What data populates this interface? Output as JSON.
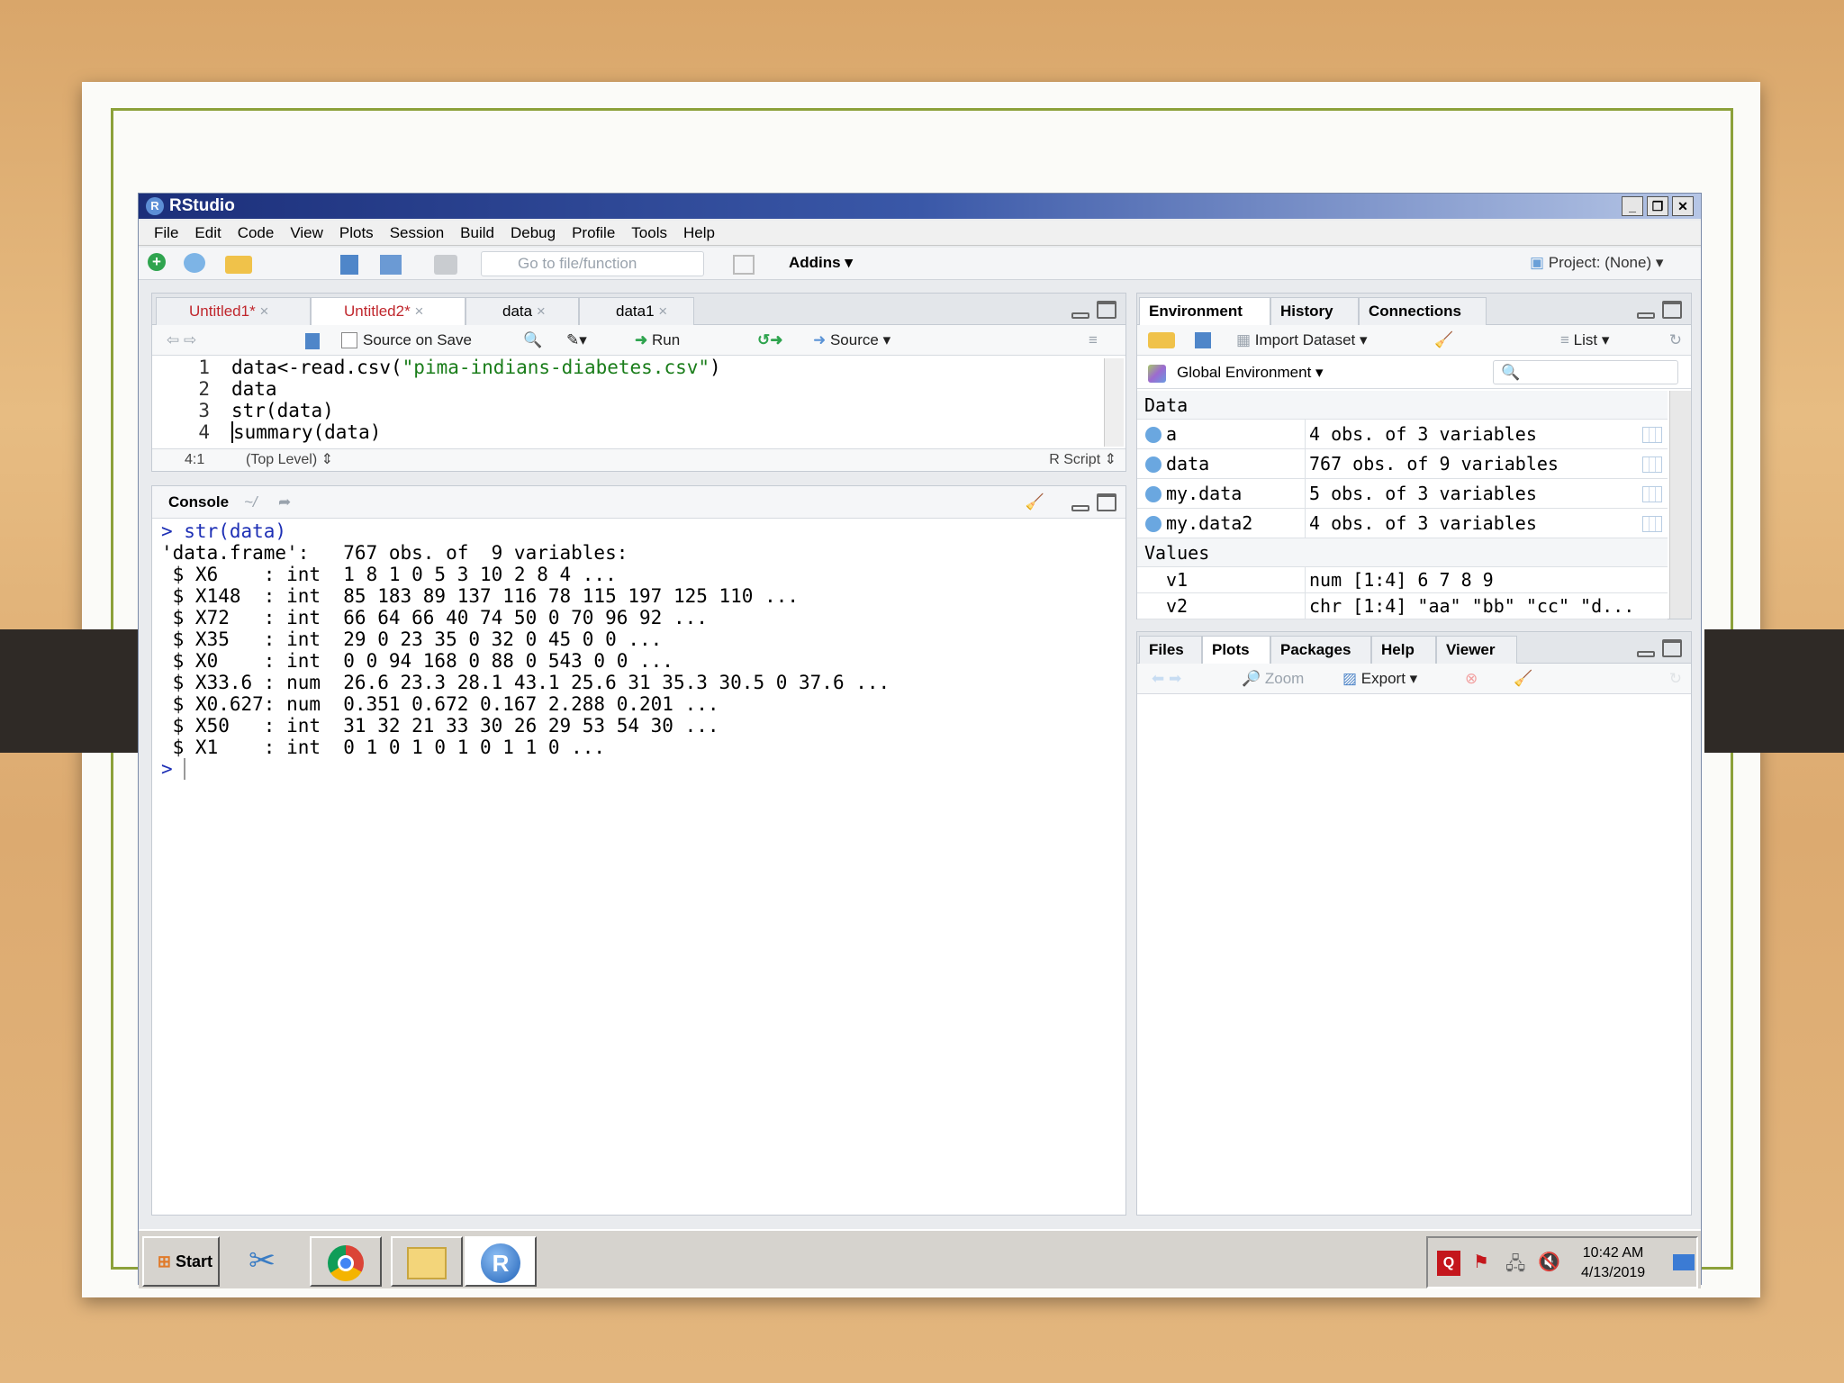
{
  "window": {
    "title": "RStudio"
  },
  "menu": [
    "File",
    "Edit",
    "Code",
    "View",
    "Plots",
    "Session",
    "Build",
    "Debug",
    "Profile",
    "Tools",
    "Help"
  ],
  "toolbar": {
    "goto_placeholder": "Go to file/function",
    "addins": "Addins",
    "project": "Project: (None)"
  },
  "editor": {
    "tabs": [
      {
        "label": "Untitled1*"
      },
      {
        "label": "Untitled2*"
      },
      {
        "label": "data"
      },
      {
        "label": "data1"
      }
    ],
    "source_on_save": "Source on Save",
    "run": "Run",
    "source": "Source",
    "lines": [
      {
        "n": "1",
        "pre": "data<-read.csv(",
        "str": "\"pima-indians-diabetes.csv\"",
        "post": ")"
      },
      {
        "n": "2",
        "pre": "data",
        "str": "",
        "post": ""
      },
      {
        "n": "3",
        "pre": "str(data)",
        "str": "",
        "post": ""
      },
      {
        "n": "4",
        "pre": "summary(data)",
        "str": "",
        "post": ""
      }
    ],
    "status": {
      "pos": "4:1",
      "scope": "(Top Level)",
      "type": "R Script"
    }
  },
  "console": {
    "title": "Console",
    "path": "~/",
    "command": "> str(data)",
    "output": [
      "'data.frame':   767 obs. of  9 variables:",
      " $ X6    : int  1 8 1 0 5 3 10 2 8 4 ...",
      " $ X148  : int  85 183 89 137 116 78 115 197 125 110 ...",
      " $ X72   : int  66 64 66 40 74 50 0 70 96 92 ...",
      " $ X35   : int  29 0 23 35 0 32 0 45 0 0 ...",
      " $ X0    : int  0 0 94 168 0 88 0 543 0 0 ...",
      " $ X33.6 : num  26.6 23.3 28.1 43.1 25.6 31 35.3 30.5 0 37.6 ...",
      " $ X0.627: num  0.351 0.672 0.167 2.288 0.201 ...",
      " $ X50   : int  31 32 21 33 30 26 29 53 54 30 ...",
      " $ X1    : int  0 1 0 1 0 1 0 1 1 0 ..."
    ],
    "prompt": ">"
  },
  "environment": {
    "tabs": [
      "Environment",
      "History",
      "Connections"
    ],
    "import": "Import Dataset",
    "list": "List",
    "scope": "Global Environment",
    "data_header": "Data",
    "data": [
      {
        "name": "a",
        "value": "4 obs. of 3 variables"
      },
      {
        "name": "data",
        "value": "767 obs. of 9 variables"
      },
      {
        "name": "my.data",
        "value": "5 obs. of 3 variables"
      },
      {
        "name": "my.data2",
        "value": "4 obs. of 3 variables"
      }
    ],
    "values_header": "Values",
    "values": [
      {
        "name": "v1",
        "value": "num [1:4] 6 7 8 9"
      },
      {
        "name": "v2",
        "value": "chr [1:4] \"aa\" \"bb\" \"cc\" \"d..."
      }
    ]
  },
  "files": {
    "tabs": [
      "Files",
      "Plots",
      "Packages",
      "Help",
      "Viewer"
    ],
    "zoom": "Zoom",
    "export": "Export"
  },
  "taskbar": {
    "start": "Start",
    "time": "10:42 AM",
    "date": "4/13/2019"
  }
}
